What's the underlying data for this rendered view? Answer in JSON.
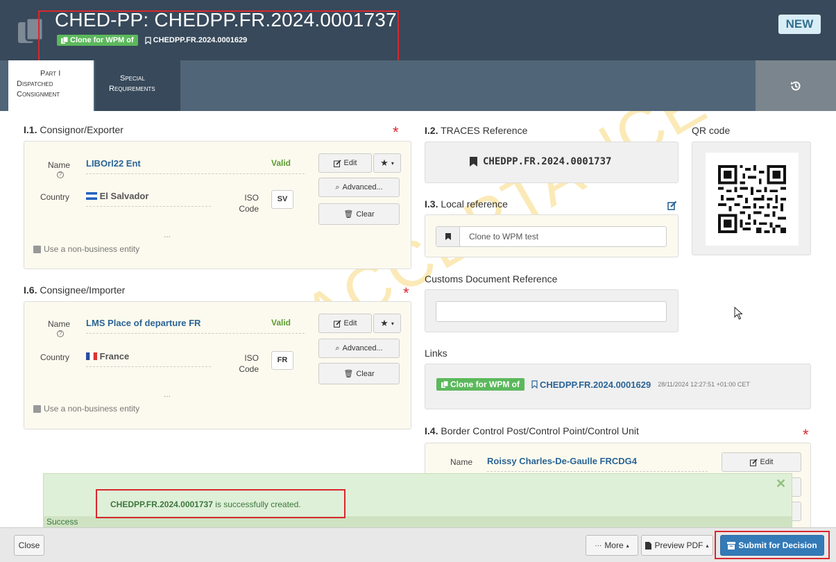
{
  "header": {
    "title": "CHED-PP: CHEDPP.FR.2024.0001737",
    "clone_label": "Clone for WPM of",
    "clone_ref": "CHEDPP.FR.2024.0001629",
    "status_badge": "NEW",
    "colors": {
      "header_bg": "#37495a",
      "badge_bg": "#d9edf7",
      "clone_green": "#5cb85c"
    }
  },
  "tabs": [
    {
      "label_line1": "Part I",
      "label_line2": "Dispatched",
      "label_line3": "Consignment"
    },
    {
      "label_line1": "Special",
      "label_line2": "Requirements"
    }
  ],
  "consignor": {
    "number": "I.1.",
    "title": "Consignor/Exporter",
    "name_label": "Name",
    "name_value": "LIBOrl22 Ent",
    "status": "Valid",
    "country_label": "Country",
    "country_value": "El Salvador",
    "iso_label": "ISO Code",
    "iso_value": "SV",
    "edit_label": "Edit",
    "advanced_label": "Advanced...",
    "clear_label": "Clear",
    "more_dots": "...",
    "non_business_label": "Use a non-business entity"
  },
  "consignee": {
    "number": "I.6.",
    "title": "Consignee/Importer",
    "name_label": "Name",
    "name_value": "LMS Place of departure FR",
    "status": "Valid",
    "country_label": "Country",
    "country_value": "France",
    "iso_label": "ISO Code",
    "iso_value": "FR",
    "edit_label": "Edit",
    "advanced_label": "Advanced...",
    "clear_label": "Clear",
    "more_dots": "...",
    "non_business_label": "Use a non-business entity"
  },
  "traces": {
    "number": "I.2.",
    "title": "TRACES Reference",
    "value": "CHEDPP.FR.2024.0001737"
  },
  "qr": {
    "title": "QR code"
  },
  "local_ref": {
    "number": "I.3.",
    "title": "Local reference",
    "value": "Clone to WPM test"
  },
  "customs": {
    "title": "Customs Document Reference",
    "value": ""
  },
  "links": {
    "title": "Links",
    "clone_label": "Clone for WPM of",
    "ref": "CHEDPP.FR.2024.0001629",
    "timestamp": "28/11/2024 12:27:51 +01:00 CET"
  },
  "bcp": {
    "number": "I.4.",
    "title": "Border Control Post/Control Point/Control Unit",
    "name_label": "Name",
    "name_value": "Roissy Charles-De-Gaulle FRCDG4",
    "edit_label": "Edit"
  },
  "watermark": "ACCEPTANCE",
  "alert": {
    "ref": "CHEDPP.FR.2024.0001737",
    "message": " is successfully created.",
    "strip": "Success",
    "close": "✕"
  },
  "footer": {
    "close_label": "Close",
    "more_label": "More",
    "preview_label": "Preview PDF",
    "submit_label": "Submit for Decision"
  }
}
